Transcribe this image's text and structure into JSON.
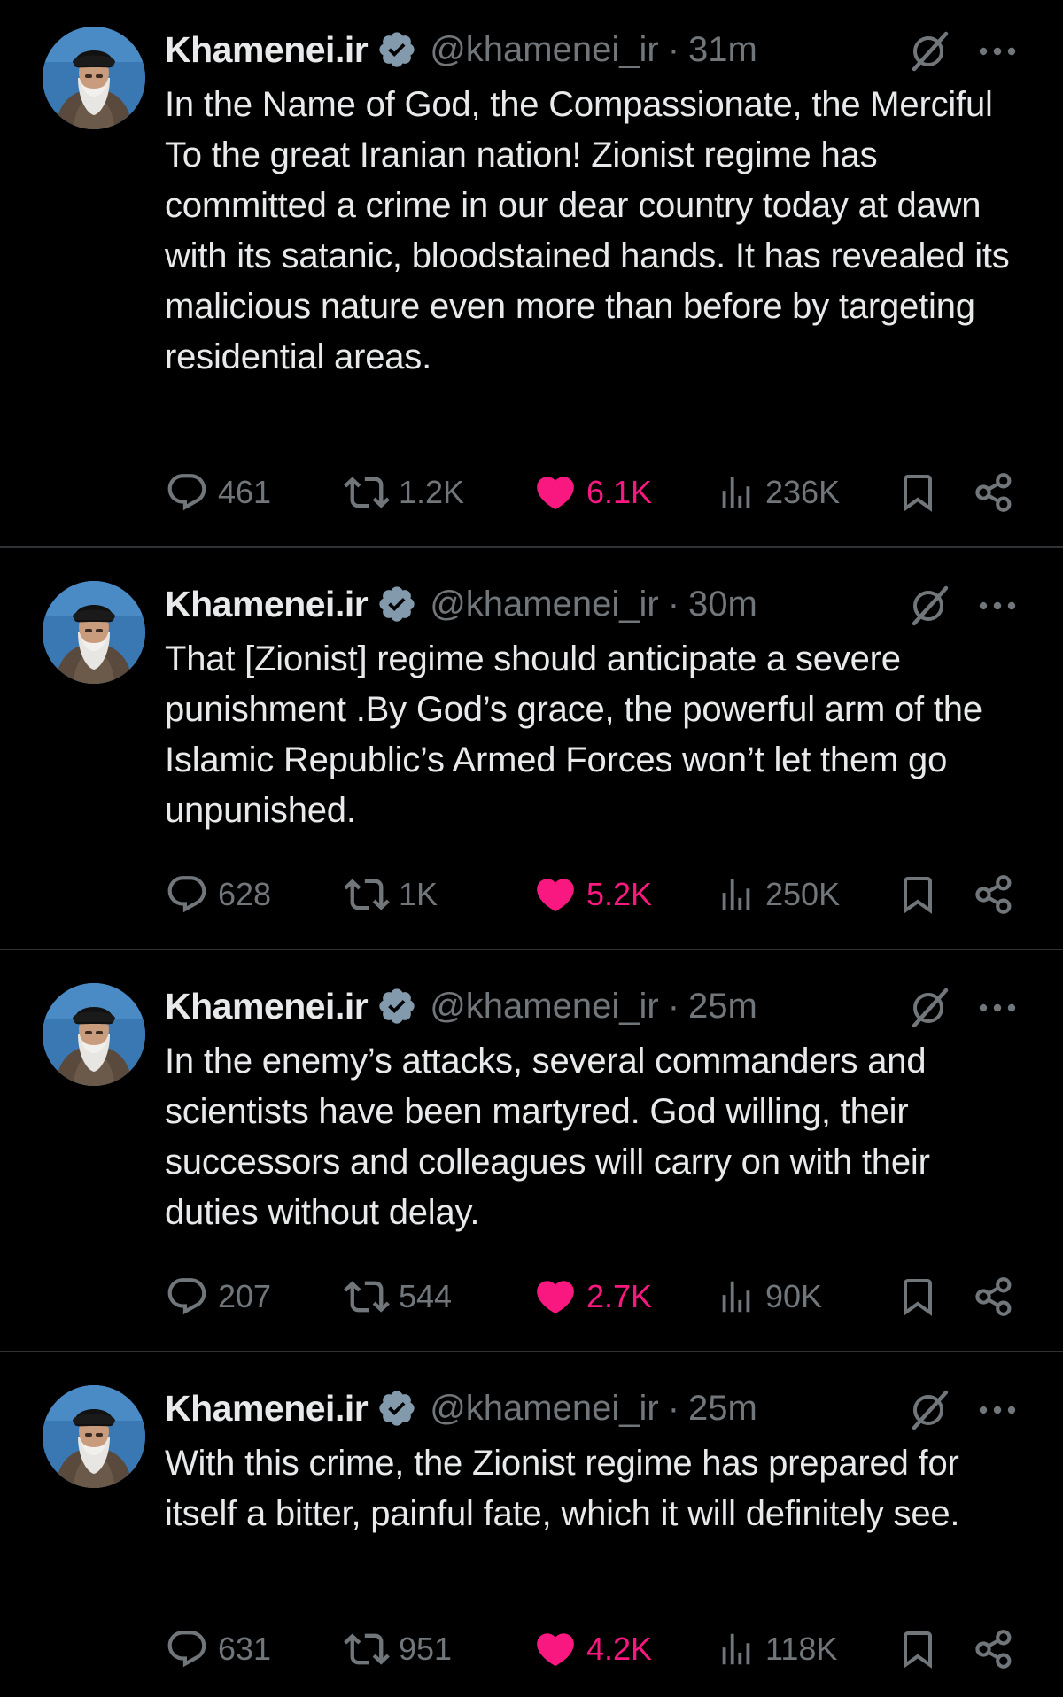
{
  "colors": {
    "background": "#000000",
    "text": "#e7e9ea",
    "muted": "#71767b",
    "like": "#f91880",
    "verified": "#829aab",
    "divider": "#2f3336"
  },
  "icons": {
    "reply": "speech-bubble-icon",
    "retweet": "retweet-icon",
    "like": "heart-filled-icon",
    "views": "bar-chart-icon",
    "bookmark": "bookmark-icon",
    "share": "share-icon",
    "grok": "grok-icon",
    "more": "more-dots-icon",
    "verified": "verified-badge-icon"
  },
  "tweets": [
    {
      "display_name": "Khamenei.ir",
      "handle": "@khamenei_ir",
      "separator": "·",
      "time": "31m",
      "text": "In the Name of God, the Compassionate, the Merciful\nTo the great Iranian nation! Zionist regime has committed a crime in our dear country today at dawn with its satanic, bloodstained hands. It has revealed its malicious nature even more than before by targeting residential areas.",
      "replies": "461",
      "retweets": "1.2K",
      "likes": "6.1K",
      "views": "236K"
    },
    {
      "display_name": "Khamenei.ir",
      "handle": "@khamenei_ir",
      "separator": "·",
      "time": "30m",
      "text": "That [Zionist] regime should anticipate a severe punishment .By God’s grace, the powerful arm of the Islamic Republic’s Armed Forces won’t let them go unpunished.",
      "replies": "628",
      "retweets": "1K",
      "likes": "5.2K",
      "views": "250K"
    },
    {
      "display_name": "Khamenei.ir",
      "handle": "@khamenei_ir",
      "separator": "·",
      "time": "25m",
      "text": "In the enemy’s attacks, several commanders and scientists have been martyred. God willing, their successors and colleagues will carry on with their duties without delay.",
      "replies": "207",
      "retweets": "544",
      "likes": "2.7K",
      "views": "90K"
    },
    {
      "display_name": "Khamenei.ir",
      "handle": "@khamenei_ir",
      "separator": "·",
      "time": "25m",
      "text": "With this crime, the Zionist regime has prepared for itself a bitter, painful fate, which it will definitely see.",
      "replies": "631",
      "retweets": "951",
      "likes": "4.2K",
      "views": "118K"
    }
  ]
}
